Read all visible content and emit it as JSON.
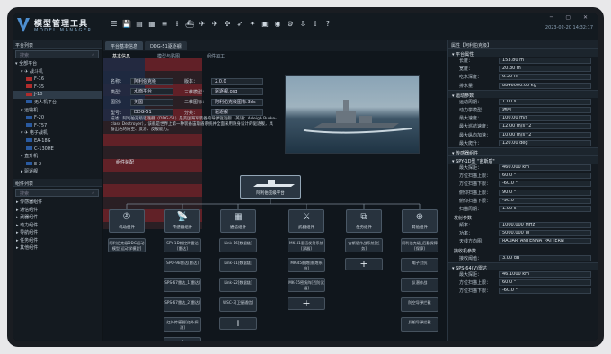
{
  "app": {
    "title": "模型管理工具",
    "subtitle": "MODEL MANAGER",
    "datetime": "2023-02-20 14:32:17",
    "window_controls": "─ ▢ ✕",
    "toolbar_icons": [
      "menu-icon",
      "save-icon",
      "save-as-icon",
      "grid-icon",
      "list-icon",
      "export-icon",
      "ship-icon",
      "aircraft-icon",
      "jet-icon",
      "helicopter-icon",
      "missile-icon",
      "satellite-icon",
      "vehicle-icon",
      "radar-icon",
      "settings-icon",
      "download-icon",
      "upload-icon",
      "help-icon"
    ],
    "toolbar_glyphs": [
      "☰",
      "💾",
      "▤",
      "▦",
      "≡",
      "⇪",
      "⛴",
      "✈",
      "✈",
      "✣",
      "➶",
      "✦",
      "▣",
      "◉",
      "⚙",
      "⇩",
      "⇧",
      "?"
    ]
  },
  "left": {
    "platform_header": "平台列表",
    "search_placeholder": "搜索",
    "platform_tree": [
      {
        "label": "▾ 全部平台",
        "indent": 0,
        "flag": ""
      },
      {
        "label": "▾ ✈ 战斗机",
        "indent": 1,
        "flag": ""
      },
      {
        "label": "F-16",
        "indent": 2,
        "flag": "r"
      },
      {
        "label": "F-35",
        "indent": 2,
        "flag": "r"
      },
      {
        "label": "J-10",
        "indent": 2,
        "flag": "r"
      },
      {
        "label": "无人机平台",
        "indent": 2,
        "flag": "b"
      },
      {
        "label": "▾ 运输机",
        "indent": 1,
        "flag": ""
      },
      {
        "label": "F-20",
        "indent": 2,
        "flag": "b"
      },
      {
        "label": "F-757",
        "indent": 2,
        "flag": "b"
      },
      {
        "label": "▾ ✈ 电子战机",
        "indent": 1,
        "flag": ""
      },
      {
        "label": "EA-18G",
        "indent": 2,
        "flag": "b"
      },
      {
        "label": "C-130HE",
        "indent": 2,
        "flag": "b"
      },
      {
        "label": "▾ 直升机",
        "indent": 1,
        "flag": ""
      },
      {
        "label": "E-2",
        "indent": 2,
        "flag": "b"
      },
      {
        "label": "▸ 驱逐舰",
        "indent": 1,
        "flag": ""
      }
    ],
    "component_header": "组件列表",
    "component_tree": [
      "▸ 传感器组件",
      "▸ 通信组件",
      "▸ 武器组件",
      "▸ 动力组件",
      "▸ 导航组件",
      "▸ 任务组件",
      "▸ 其他组件"
    ]
  },
  "main": {
    "tabs": [
      "平台基本信息",
      "DDG-51驱逐舰"
    ],
    "subtabs": [
      "基本信息",
      "模型与贴图",
      "组件加工"
    ],
    "form": [
      {
        "label": "名称：",
        "value": "阿利伯克级",
        "label2": "版本：",
        "value2": "2.0.0"
      },
      {
        "label": "类型：",
        "value": "水面平台",
        "label2": "三维模型：",
        "value2": "驱逐舰.osg"
      },
      {
        "label": "国别：",
        "value": "美国",
        "label2": "二维图标：",
        "value2": "阿利伯克级图标.3ds"
      },
      {
        "label": "型号：",
        "value": "DDG-51",
        "label2": "分类：",
        "value2": "驱逐舰"
      }
    ],
    "desc_label": "描述：",
    "description": "阿利伯克级驱逐舰（DDG-51）是美国海军装备的导弹驱逐舰（英语：Arleigh Burke-class Destroyer），该舰是世界上第一种装备宙斯盾系统并全面采用隐身设计的驱逐舰，具备出色的防空、反潜、反舰能力。",
    "section_title": "组件装配",
    "center_label": "阿利伯克级平台",
    "categories": [
      "机动组件",
      "传感器组件",
      "通信组件",
      "武器组件",
      "任务组件",
      "其他组件"
    ],
    "category_glyphs": [
      "✇",
      "📡",
      "▦",
      "⚔",
      "⧉",
      "⊕"
    ],
    "module_col1": [
      "阿利伯克级DDG运动模型[运动学模型]"
    ],
    "module_col2": [
      "SPY-1D相控阵雷达[雷达]",
      "SPQ-9B雷达[雷达]",
      "SPS-67雷达_1[雷达]",
      "SPS-67雷达_2[雷达]",
      "红外传感器[红外探测]"
    ],
    "module_col3": [
      "Link-16[数据链]",
      "Link-11[数据链]",
      "Link-22[数据链]",
      "WSC-3[卫星通信]"
    ],
    "module_col4": [
      "MK-41垂直发射系统[武器]",
      "MK-45舰炮[舰炮系统]",
      "MK-15密集阵[近防武器]"
    ],
    "module_col5": [
      "宙斯盾作战系统[任务]"
    ],
    "module_col6": [
      "阿利伯克级_后勤保障[保障]",
      "电子对抗",
      "反潜作战",
      "防空导弹拦截",
      "反舰导弹拦截"
    ],
    "add": "+"
  },
  "right": {
    "header": "属性【阿利伯克级】",
    "sections": [
      {
        "title": "▾ 平台属性",
        "rows": [
          [
            "长度：",
            "153.80 m"
          ],
          [
            "宽度：",
            "20.30 m"
          ],
          [
            "吃水深度：",
            "6.30 m"
          ],
          [
            "排水量：",
            "8846000.00 kg"
          ]
        ]
      },
      {
        "title": "▾ 运动参数",
        "rows": [
          [
            "运动周期：",
            "1.00 s"
          ],
          [
            "动力学模型：",
            "通用"
          ],
          [
            "最大速度：",
            "100.00 m/s"
          ],
          [
            "最大巡航速度：",
            "12.00 m/s^2"
          ],
          [
            "最大纵向加速：",
            "10.00 m/s^2"
          ],
          [
            "最大爬升：",
            "120.00 deg"
          ]
        ]
      },
      {
        "title": "▾ 传感器组件",
        "rows": []
      },
      {
        "title": "▾ SPY-1D型 \"宙斯盾\"",
        "rows": [
          [
            "最大探距：",
            "460.000 km"
          ],
          [
            "方位扫描上限：",
            "60.0 °"
          ],
          [
            "方位扫描下限：",
            "-60.0 °"
          ],
          [
            "俯仰扫描上限：",
            "90.0 °"
          ],
          [
            "俯仰扫描下限：",
            "-90.0 °"
          ],
          [
            "扫描周期：",
            "1.00 s"
          ],
          [
            "发射参数",
            ""
          ],
          [
            "频率：",
            "1000.000 MHz"
          ],
          [
            "功率：",
            "5000.000 W"
          ],
          [
            "天线方向图：",
            "RADAR_ANTENNA_PATTERN"
          ],
          [
            "接收机参数",
            ""
          ],
          [
            "接收阈值：",
            "3.00 dB"
          ]
        ]
      },
      {
        "title": "▾ SPS-64(V)雷达",
        "rows": [
          [
            "最大探距：",
            "46.1000 km"
          ],
          [
            "方位扫描上限：",
            "60.0 °"
          ],
          [
            "方位扫描下限：",
            "-60.0 °"
          ]
        ]
      }
    ]
  }
}
